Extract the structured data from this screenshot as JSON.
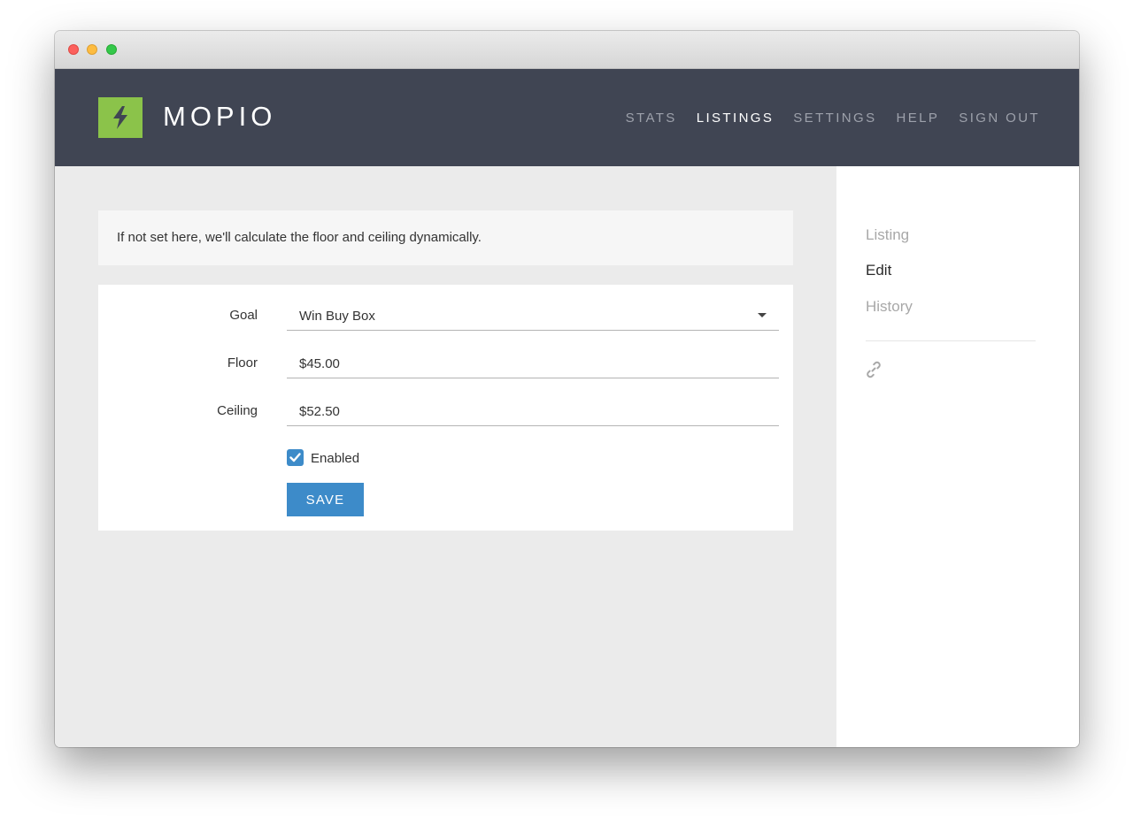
{
  "app": {
    "brand": "MOPIO",
    "logo_icon": "bolt-icon",
    "accent_color": "#8bc34a",
    "header_color": "#404553",
    "primary_color": "#3d8bc9"
  },
  "nav": {
    "items": [
      {
        "label": "STATS",
        "active": false
      },
      {
        "label": "LISTINGS",
        "active": true
      },
      {
        "label": "SETTINGS",
        "active": false
      },
      {
        "label": "HELP",
        "active": false
      },
      {
        "label": "SIGN OUT",
        "active": false
      }
    ]
  },
  "notice": {
    "text": "If not set here, we'll calculate the floor and ceiling dynamically."
  },
  "form": {
    "goal": {
      "label": "Goal",
      "value": "Win Buy Box"
    },
    "floor": {
      "label": "Floor",
      "value": "$45.00"
    },
    "ceiling": {
      "label": "Ceiling",
      "value": "$52.50"
    },
    "enabled": {
      "label": "Enabled",
      "checked": true
    },
    "save_label": "SAVE"
  },
  "sidebar": {
    "items": [
      {
        "label": "Listing",
        "active": false
      },
      {
        "label": "Edit",
        "active": true
      },
      {
        "label": "History",
        "active": false
      }
    ],
    "link_icon": "link-icon"
  }
}
